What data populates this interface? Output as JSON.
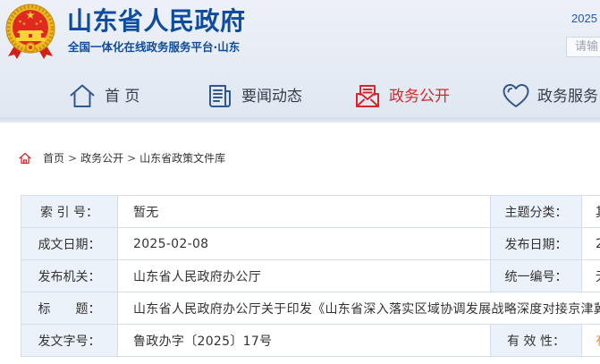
{
  "site": {
    "title": "山东省人民政府",
    "subtitle": "全国一体化在线政务服务平台·山东",
    "date_text": "2025",
    "search_placeholder": "请输",
    "logo_icon": "national-emblem-icon"
  },
  "nav": {
    "items": [
      {
        "label": "首 页",
        "icon": "home-icon",
        "active": false
      },
      {
        "label": "要闻动态",
        "icon": "newspaper-icon",
        "active": false
      },
      {
        "label": "政务公开",
        "icon": "open-government-icon",
        "active": true
      },
      {
        "label": "政务服务",
        "icon": "heart-icon",
        "active": false
      }
    ]
  },
  "breadcrumb": {
    "icon": "home-icon",
    "separator": ">",
    "items": [
      "首页",
      "政务公开",
      "山东省政策文件库"
    ]
  },
  "document_info": {
    "rows": [
      {
        "left": {
          "label": "索 引 号：",
          "value": "暂无"
        },
        "right": {
          "label": "主题分类：",
          "value": "其"
        }
      },
      {
        "left": {
          "label": "成文日期：",
          "value": "2025-02-08"
        },
        "right": {
          "label": "发布日期：",
          "value": "2"
        }
      },
      {
        "left": {
          "label": "发布机关：",
          "value": "山东省人民政府办公厅"
        },
        "right": {
          "label": "统一编号：",
          "value": "无"
        }
      },
      {
        "left": {
          "label": "标　　题：",
          "value": "山东省人民政府办公厅关于印发《山东省深入落实区域协调发展战略深度对接京津冀"
        }
      },
      {
        "left": {
          "label": "发文字号：",
          "value": "鲁政办字〔2025〕17号"
        },
        "right": {
          "label": "有 效 性：",
          "value": "有"
        }
      }
    ]
  },
  "colors": {
    "brand_blue": "#0e4c9f",
    "active_red": "#d7262b",
    "validity_orange": "#e8952a",
    "label_bg": "#ebf2fa",
    "table_border": "#d4deeb",
    "nav_icon": "#33568c"
  }
}
